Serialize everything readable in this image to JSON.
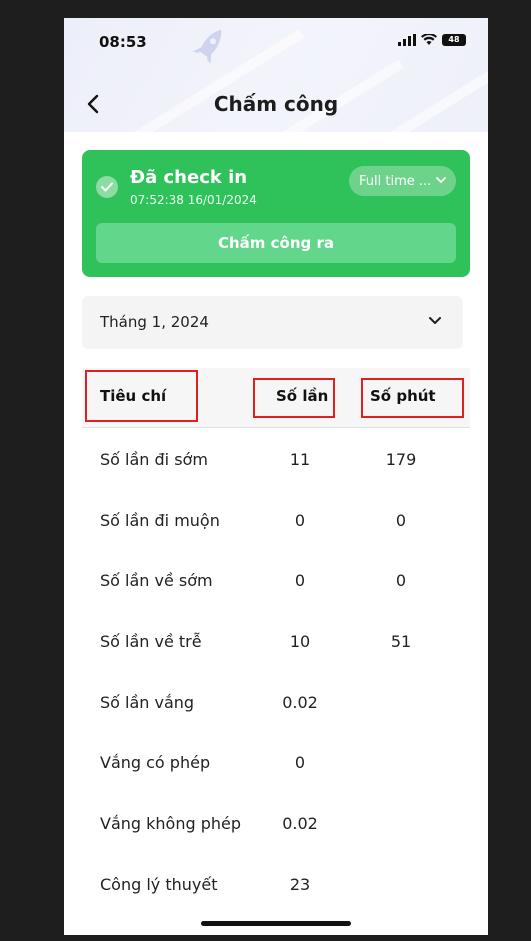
{
  "status_bar": {
    "time": "08:53",
    "battery": "48"
  },
  "header": {
    "title": "Chấm công"
  },
  "checkin": {
    "title": "Đã check in",
    "timestamp": "07:52:38 16/01/2024",
    "shift": "Full time ...",
    "checkout_label": "Chấm công ra"
  },
  "month_filter": {
    "value": "Tháng 1, 2024"
  },
  "table": {
    "headers": [
      "Tiêu chí",
      "Số lần",
      "Số phút"
    ],
    "rows": [
      [
        "Số lần đi sớm",
        "11",
        "179"
      ],
      [
        "Số lần đi muộn",
        "0",
        "0"
      ],
      [
        "Số lần về sớm",
        "0",
        "0"
      ],
      [
        "Số lần về trễ",
        "10",
        "51"
      ],
      [
        "Số lần vắng",
        "0.02",
        ""
      ],
      [
        "Vắng có phép",
        "0",
        ""
      ],
      [
        "Vắng không phép",
        "0.02",
        ""
      ],
      [
        "Công lý thuyết",
        "23",
        ""
      ]
    ]
  },
  "colors": {
    "accent_green": "#2fc15a",
    "highlight_red": "#e02020"
  }
}
